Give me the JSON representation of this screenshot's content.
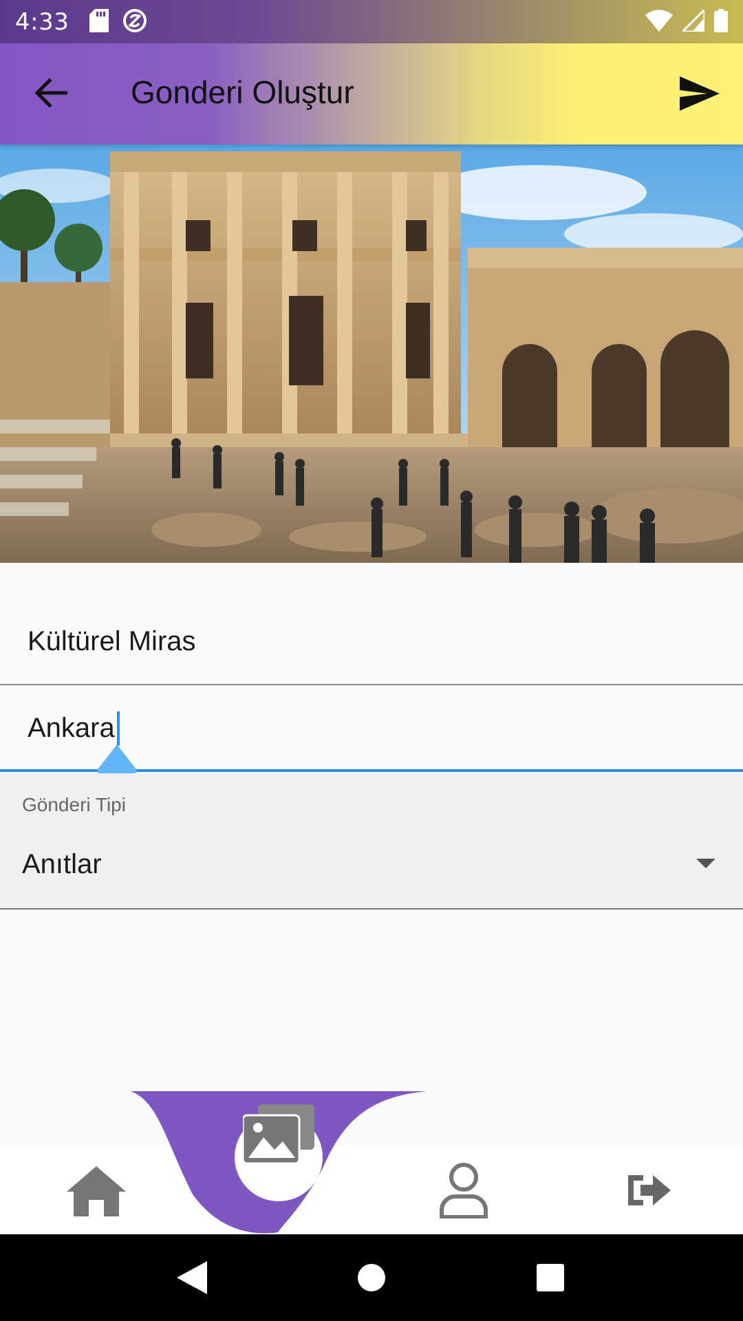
{
  "status_bar": {
    "time": "4:33",
    "left_icons": [
      "sd-card-icon",
      "sync-icon"
    ],
    "right_icons": [
      "wifi-icon",
      "signal-icon",
      "battery-icon"
    ]
  },
  "app_bar": {
    "title": "Gonderi Oluştur",
    "back_icon": "arrow-back-icon",
    "send_icon": "send-icon",
    "gradient_colors": [
      "#8457c3",
      "#fff176"
    ]
  },
  "hero_image": {
    "subject": "ancient library ruins photo"
  },
  "form": {
    "title_field": {
      "value": "Kültürel Miras"
    },
    "location_field": {
      "value": "Ankara",
      "focused": true
    },
    "type_dropdown": {
      "label": "Gönderi Tipi",
      "value": "Anıtlar"
    }
  },
  "colors": {
    "accent": "#8457c3",
    "focus_blue": "#2f8ef0",
    "cursor_handle": "#64b5f6"
  },
  "bottom_nav": {
    "items": [
      {
        "icon": "home-icon",
        "active": false
      },
      {
        "icon": "photo-library-icon",
        "active": true
      },
      {
        "icon": "person-icon",
        "active": false
      },
      {
        "icon": "logout-icon",
        "active": false
      }
    ]
  },
  "system_nav": {
    "buttons": [
      "back-triangle-icon",
      "home-circle-icon",
      "recents-square-icon"
    ]
  }
}
